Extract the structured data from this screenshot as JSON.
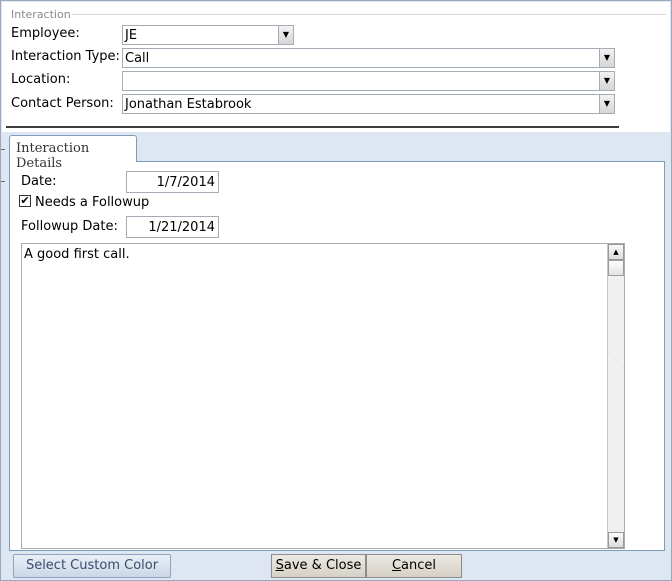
{
  "form": {
    "caption": "Interaction"
  },
  "fields": {
    "employee": {
      "label": "Employee:",
      "value": "JE"
    },
    "interaction_type": {
      "label": "Interaction Type:",
      "value": "Call"
    },
    "location": {
      "label": "Location:",
      "value": ""
    },
    "contact_person": {
      "label": "Contact Person:",
      "value": "Jonathan Estabrook"
    }
  },
  "tabs": [
    {
      "label": "Interaction Details",
      "selected": true
    }
  ],
  "details": {
    "date_label": "Date:",
    "date_value": "1/7/2014",
    "needs_followup_label": "Needs a Followup",
    "needs_followup_checked": true,
    "check_mark": "✔",
    "followup_date_label": "Followup Date:",
    "followup_date_value": "1/21/2014",
    "notes": "A good first call."
  },
  "buttons": {
    "select_custom_color": "Select Custom Color",
    "save_close_prefix": "S",
    "save_close_rest": "ave & Close",
    "cancel_prefix": "C",
    "cancel_rest": "ancel"
  },
  "colors": {
    "background": "#dee6f2",
    "tab_border": "#7f9db9",
    "custom_color_text": "#3a4d6b"
  }
}
